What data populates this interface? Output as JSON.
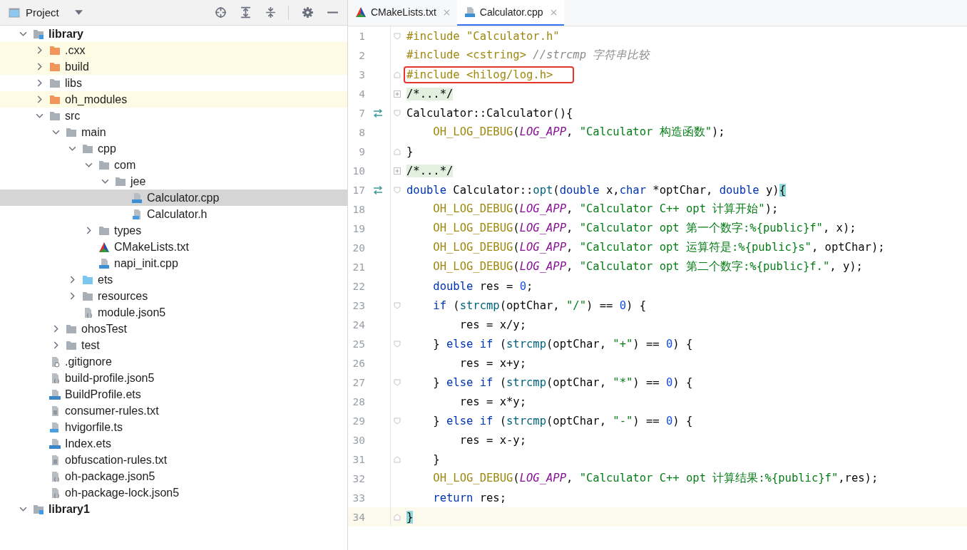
{
  "project_panel": {
    "title": "Project"
  },
  "tree": [
    {
      "label": "library",
      "kind": "module",
      "bold": true,
      "expanded": true,
      "selected": false,
      "ignored": false,
      "children": [
        {
          "label": ".cxx",
          "kind": "folder-orange",
          "expanded": false,
          "selected": false,
          "ignored": true
        },
        {
          "label": "build",
          "kind": "folder-orange",
          "expanded": false,
          "selected": false,
          "ignored": true
        },
        {
          "label": "libs",
          "kind": "folder",
          "expanded": false,
          "selected": false,
          "ignored": false
        },
        {
          "label": "oh_modules",
          "kind": "folder-orange",
          "expanded": false,
          "selected": false,
          "ignored": true
        },
        {
          "label": "src",
          "kind": "folder",
          "expanded": true,
          "selected": false,
          "ignored": false,
          "children": [
            {
              "label": "main",
              "kind": "folder",
              "expanded": true,
              "selected": false,
              "ignored": false,
              "children": [
                {
                  "label": "cpp",
                  "kind": "folder",
                  "expanded": true,
                  "selected": false,
                  "ignored": false,
                  "children": [
                    {
                      "label": "com",
                      "kind": "folder",
                      "expanded": true,
                      "selected": false,
                      "ignored": false,
                      "children": [
                        {
                          "label": "jee",
                          "kind": "folder",
                          "expanded": true,
                          "selected": false,
                          "ignored": false,
                          "children": [
                            {
                              "label": "Calculator.cpp",
                              "kind": "cpp",
                              "selected": true,
                              "ignored": false
                            },
                            {
                              "label": "Calculator.h",
                              "kind": "h",
                              "selected": false,
                              "ignored": false
                            }
                          ]
                        }
                      ]
                    },
                    {
                      "label": "types",
                      "kind": "folder",
                      "expanded": false,
                      "selected": false,
                      "ignored": false
                    },
                    {
                      "label": "CMakeLists.txt",
                      "kind": "cmake",
                      "selected": false,
                      "ignored": false
                    },
                    {
                      "label": "napi_init.cpp",
                      "kind": "cpp",
                      "selected": false,
                      "ignored": false
                    }
                  ]
                },
                {
                  "label": "ets",
                  "kind": "folder-blue",
                  "expanded": false,
                  "selected": false,
                  "ignored": false
                },
                {
                  "label": "resources",
                  "kind": "folder",
                  "expanded": false,
                  "selected": false,
                  "ignored": false
                },
                {
                  "label": "module.json5",
                  "kind": "json",
                  "selected": false,
                  "ignored": false
                }
              ]
            },
            {
              "label": "ohosTest",
              "kind": "folder",
              "expanded": false,
              "selected": false,
              "ignored": false
            },
            {
              "label": "test",
              "kind": "folder",
              "expanded": false,
              "selected": false,
              "ignored": false
            }
          ]
        },
        {
          "label": ".gitignore",
          "kind": "gitignore",
          "selected": false,
          "ignored": false
        },
        {
          "label": "build-profile.json5",
          "kind": "json",
          "selected": false,
          "ignored": false
        },
        {
          "label": "BuildProfile.ets",
          "kind": "ets",
          "selected": false,
          "ignored": false
        },
        {
          "label": "consumer-rules.txt",
          "kind": "text",
          "selected": false,
          "ignored": false
        },
        {
          "label": "hvigorfile.ts",
          "kind": "ts",
          "selected": false,
          "ignored": false
        },
        {
          "label": "Index.ets",
          "kind": "ets",
          "selected": false,
          "ignored": false
        },
        {
          "label": "obfuscation-rules.txt",
          "kind": "text",
          "selected": false,
          "ignored": false
        },
        {
          "label": "oh-package.json5",
          "kind": "json",
          "selected": false,
          "ignored": false
        },
        {
          "label": "oh-package-lock.json5",
          "kind": "json",
          "selected": false,
          "ignored": false
        }
      ]
    },
    {
      "label": "library1",
      "kind": "module",
      "bold": true,
      "expanded": true,
      "selected": false,
      "ignored": false
    }
  ],
  "tabs": [
    {
      "label": "CMakeLists.txt",
      "kind": "cmake",
      "selected": false
    },
    {
      "label": "Calculator.cpp",
      "kind": "cpp",
      "selected": true
    }
  ],
  "lines": [
    {
      "n": "1",
      "fold_marker": {
        "kind": "open"
      },
      "override": false,
      "current": false,
      "boxed": false,
      "tokens": [
        {
          "kind": "dir",
          "text": "#include \"Calculator.h\""
        }
      ]
    },
    {
      "n": "2",
      "override": false,
      "current": false,
      "boxed": false,
      "tokens": [
        {
          "kind": "dir",
          "text": "#include <cstring> "
        },
        {
          "kind": "comment",
          "text": "//strcmp 字符串比较"
        }
      ]
    },
    {
      "n": "3",
      "fold_marker": {
        "kind": "close"
      },
      "override": false,
      "current": false,
      "boxed": true,
      "tokens": [
        {
          "kind": "dir",
          "text": "#include <hilog/log.h>"
        }
      ]
    },
    {
      "n": "4",
      "fold_marker": {
        "kind": "collapsed"
      },
      "override": false,
      "current": false,
      "boxed": false,
      "tokens": [
        {
          "kind": "folded",
          "text": "/*...*/"
        }
      ]
    },
    {
      "n": "7",
      "fold_marker": {
        "kind": "open"
      },
      "override": true,
      "current": false,
      "boxed": false,
      "tokens": [
        {
          "kind": "plain",
          "text": "Calculator::Calculator(){"
        }
      ]
    },
    {
      "n": "8",
      "override": false,
      "current": false,
      "boxed": false,
      "tokens": [
        {
          "kind": "macro",
          "text": "    OH_LOG_DEBUG"
        },
        {
          "kind": "plain",
          "text": "("
        },
        {
          "kind": "const",
          "text": "LOG_APP"
        },
        {
          "kind": "plain",
          "text": ", "
        },
        {
          "kind": "str",
          "text": "\"Calculator 构造函数\""
        },
        {
          "kind": "plain",
          "text": ");"
        }
      ]
    },
    {
      "n": "9",
      "fold_marker": {
        "kind": "close"
      },
      "override": false,
      "current": false,
      "boxed": false,
      "tokens": [
        {
          "kind": "plain",
          "text": "}"
        }
      ]
    },
    {
      "n": "10",
      "fold_marker": {
        "kind": "collapsed"
      },
      "override": false,
      "current": false,
      "boxed": false,
      "tokens": [
        {
          "kind": "folded",
          "text": "/*...*/"
        }
      ]
    },
    {
      "n": "17",
      "fold_marker": {
        "kind": "open"
      },
      "override": true,
      "current": false,
      "boxed": false,
      "tokens": [
        {
          "kind": "kw",
          "text": "double"
        },
        {
          "kind": "plain",
          "text": " Calculator::"
        },
        {
          "kind": "fn",
          "text": "opt"
        },
        {
          "kind": "plain",
          "text": "("
        },
        {
          "kind": "kw",
          "text": "double"
        },
        {
          "kind": "plain",
          "text": " x,"
        },
        {
          "kind": "kw",
          "text": "char"
        },
        {
          "kind": "plain",
          "text": " *optChar, "
        },
        {
          "kind": "kw",
          "text": "double"
        },
        {
          "kind": "plain",
          "text": " y)"
        },
        {
          "kind": "match",
          "text": "{"
        }
      ]
    },
    {
      "n": "18",
      "override": false,
      "current": false,
      "boxed": false,
      "tokens": [
        {
          "kind": "macro",
          "text": "    OH_LOG_DEBUG"
        },
        {
          "kind": "plain",
          "text": "("
        },
        {
          "kind": "const",
          "text": "LOG_APP"
        },
        {
          "kind": "plain",
          "text": ", "
        },
        {
          "kind": "str",
          "text": "\"Calculator C++ opt 计算开始\""
        },
        {
          "kind": "plain",
          "text": ");"
        }
      ]
    },
    {
      "n": "19",
      "override": false,
      "current": false,
      "boxed": false,
      "tokens": [
        {
          "kind": "macro",
          "text": "    OH_LOG_DEBUG"
        },
        {
          "kind": "plain",
          "text": "("
        },
        {
          "kind": "const",
          "text": "LOG_APP"
        },
        {
          "kind": "plain",
          "text": ", "
        },
        {
          "kind": "str",
          "text": "\"Calculator opt 第一个数字:%{public}f\""
        },
        {
          "kind": "plain",
          "text": ", x);"
        }
      ]
    },
    {
      "n": "20",
      "override": false,
      "current": false,
      "boxed": false,
      "tokens": [
        {
          "kind": "macro",
          "text": "    OH_LOG_DEBUG"
        },
        {
          "kind": "plain",
          "text": "("
        },
        {
          "kind": "const",
          "text": "LOG_APP"
        },
        {
          "kind": "plain",
          "text": ", "
        },
        {
          "kind": "str",
          "text": "\"Calculator opt 运算符是:%{public}s\""
        },
        {
          "kind": "plain",
          "text": ", optChar);"
        }
      ]
    },
    {
      "n": "21",
      "override": false,
      "current": false,
      "boxed": false,
      "tokens": [
        {
          "kind": "macro",
          "text": "    OH_LOG_DEBUG"
        },
        {
          "kind": "plain",
          "text": "("
        },
        {
          "kind": "const",
          "text": "LOG_APP"
        },
        {
          "kind": "plain",
          "text": ", "
        },
        {
          "kind": "str",
          "text": "\"Calculator opt 第二个数字:%{public}f.\""
        },
        {
          "kind": "plain",
          "text": ", y);"
        }
      ]
    },
    {
      "n": "22",
      "override": false,
      "current": false,
      "boxed": false,
      "tokens": [
        {
          "kind": "kw",
          "text": "    double"
        },
        {
          "kind": "plain",
          "text": " res = "
        },
        {
          "kind": "num",
          "text": "0"
        },
        {
          "kind": "plain",
          "text": ";"
        }
      ]
    },
    {
      "n": "23",
      "fold_marker": {
        "kind": "open"
      },
      "override": false,
      "current": false,
      "boxed": false,
      "tokens": [
        {
          "kind": "kw",
          "text": "    if"
        },
        {
          "kind": "plain",
          "text": " ("
        },
        {
          "kind": "fn",
          "text": "strcmp"
        },
        {
          "kind": "plain",
          "text": "(optChar, "
        },
        {
          "kind": "str",
          "text": "\"/\""
        },
        {
          "kind": "plain",
          "text": ") == "
        },
        {
          "kind": "num",
          "text": "0"
        },
        {
          "kind": "plain",
          "text": ") {"
        }
      ]
    },
    {
      "n": "24",
      "override": false,
      "current": false,
      "boxed": false,
      "tokens": [
        {
          "kind": "plain",
          "text": "        res = x/y;"
        }
      ]
    },
    {
      "n": "25",
      "fold_marker": {
        "kind": "open"
      },
      "override": false,
      "current": false,
      "boxed": false,
      "tokens": [
        {
          "kind": "plain",
          "text": "    } "
        },
        {
          "kind": "kw",
          "text": "else if"
        },
        {
          "kind": "plain",
          "text": " ("
        },
        {
          "kind": "fn",
          "text": "strcmp"
        },
        {
          "kind": "plain",
          "text": "(optChar, "
        },
        {
          "kind": "str",
          "text": "\"+\""
        },
        {
          "kind": "plain",
          "text": ") == "
        },
        {
          "kind": "num",
          "text": "0"
        },
        {
          "kind": "plain",
          "text": ") {"
        }
      ]
    },
    {
      "n": "26",
      "override": false,
      "current": false,
      "boxed": false,
      "tokens": [
        {
          "kind": "plain",
          "text": "        res = x+y;"
        }
      ]
    },
    {
      "n": "27",
      "fold_marker": {
        "kind": "open"
      },
      "override": false,
      "current": false,
      "boxed": false,
      "tokens": [
        {
          "kind": "plain",
          "text": "    } "
        },
        {
          "kind": "kw",
          "text": "else if"
        },
        {
          "kind": "plain",
          "text": " ("
        },
        {
          "kind": "fn",
          "text": "strcmp"
        },
        {
          "kind": "plain",
          "text": "(optChar, "
        },
        {
          "kind": "str",
          "text": "\"*\""
        },
        {
          "kind": "plain",
          "text": ") == "
        },
        {
          "kind": "num",
          "text": "0"
        },
        {
          "kind": "plain",
          "text": ") {"
        }
      ]
    },
    {
      "n": "28",
      "override": false,
      "current": false,
      "boxed": false,
      "tokens": [
        {
          "kind": "plain",
          "text": "        res = x*y;"
        }
      ]
    },
    {
      "n": "29",
      "fold_marker": {
        "kind": "open"
      },
      "override": false,
      "current": false,
      "boxed": false,
      "tokens": [
        {
          "kind": "plain",
          "text": "    } "
        },
        {
          "kind": "kw",
          "text": "else if"
        },
        {
          "kind": "plain",
          "text": " ("
        },
        {
          "kind": "fn",
          "text": "strcmp"
        },
        {
          "kind": "plain",
          "text": "(optChar, "
        },
        {
          "kind": "str",
          "text": "\"-\""
        },
        {
          "kind": "plain",
          "text": ") == "
        },
        {
          "kind": "num",
          "text": "0"
        },
        {
          "kind": "plain",
          "text": ") {"
        }
      ]
    },
    {
      "n": "30",
      "override": false,
      "current": false,
      "boxed": false,
      "tokens": [
        {
          "kind": "plain",
          "text": "        res = x-y;"
        }
      ]
    },
    {
      "n": "31",
      "fold_marker": {
        "kind": "close"
      },
      "override": false,
      "current": false,
      "boxed": false,
      "tokens": [
        {
          "kind": "plain",
          "text": "    }"
        }
      ]
    },
    {
      "n": "32",
      "override": false,
      "current": false,
      "boxed": false,
      "tokens": [
        {
          "kind": "macro",
          "text": "    OH_LOG_DEBUG"
        },
        {
          "kind": "plain",
          "text": "("
        },
        {
          "kind": "const",
          "text": "LOG_APP"
        },
        {
          "kind": "plain",
          "text": ", "
        },
        {
          "kind": "str",
          "text": "\"Calculator C++ opt 计算结果:%{public}f\""
        },
        {
          "kind": "plain",
          "text": ",res);"
        }
      ]
    },
    {
      "n": "33",
      "override": false,
      "current": false,
      "boxed": false,
      "tokens": [
        {
          "kind": "kw",
          "text": "    return"
        },
        {
          "kind": "plain",
          "text": " res;"
        }
      ]
    },
    {
      "n": "34",
      "fold_marker": {
        "kind": "close"
      },
      "override": false,
      "current": true,
      "boxed": false,
      "tokens": [
        {
          "kind": "match",
          "text": "}"
        }
      ]
    }
  ]
}
